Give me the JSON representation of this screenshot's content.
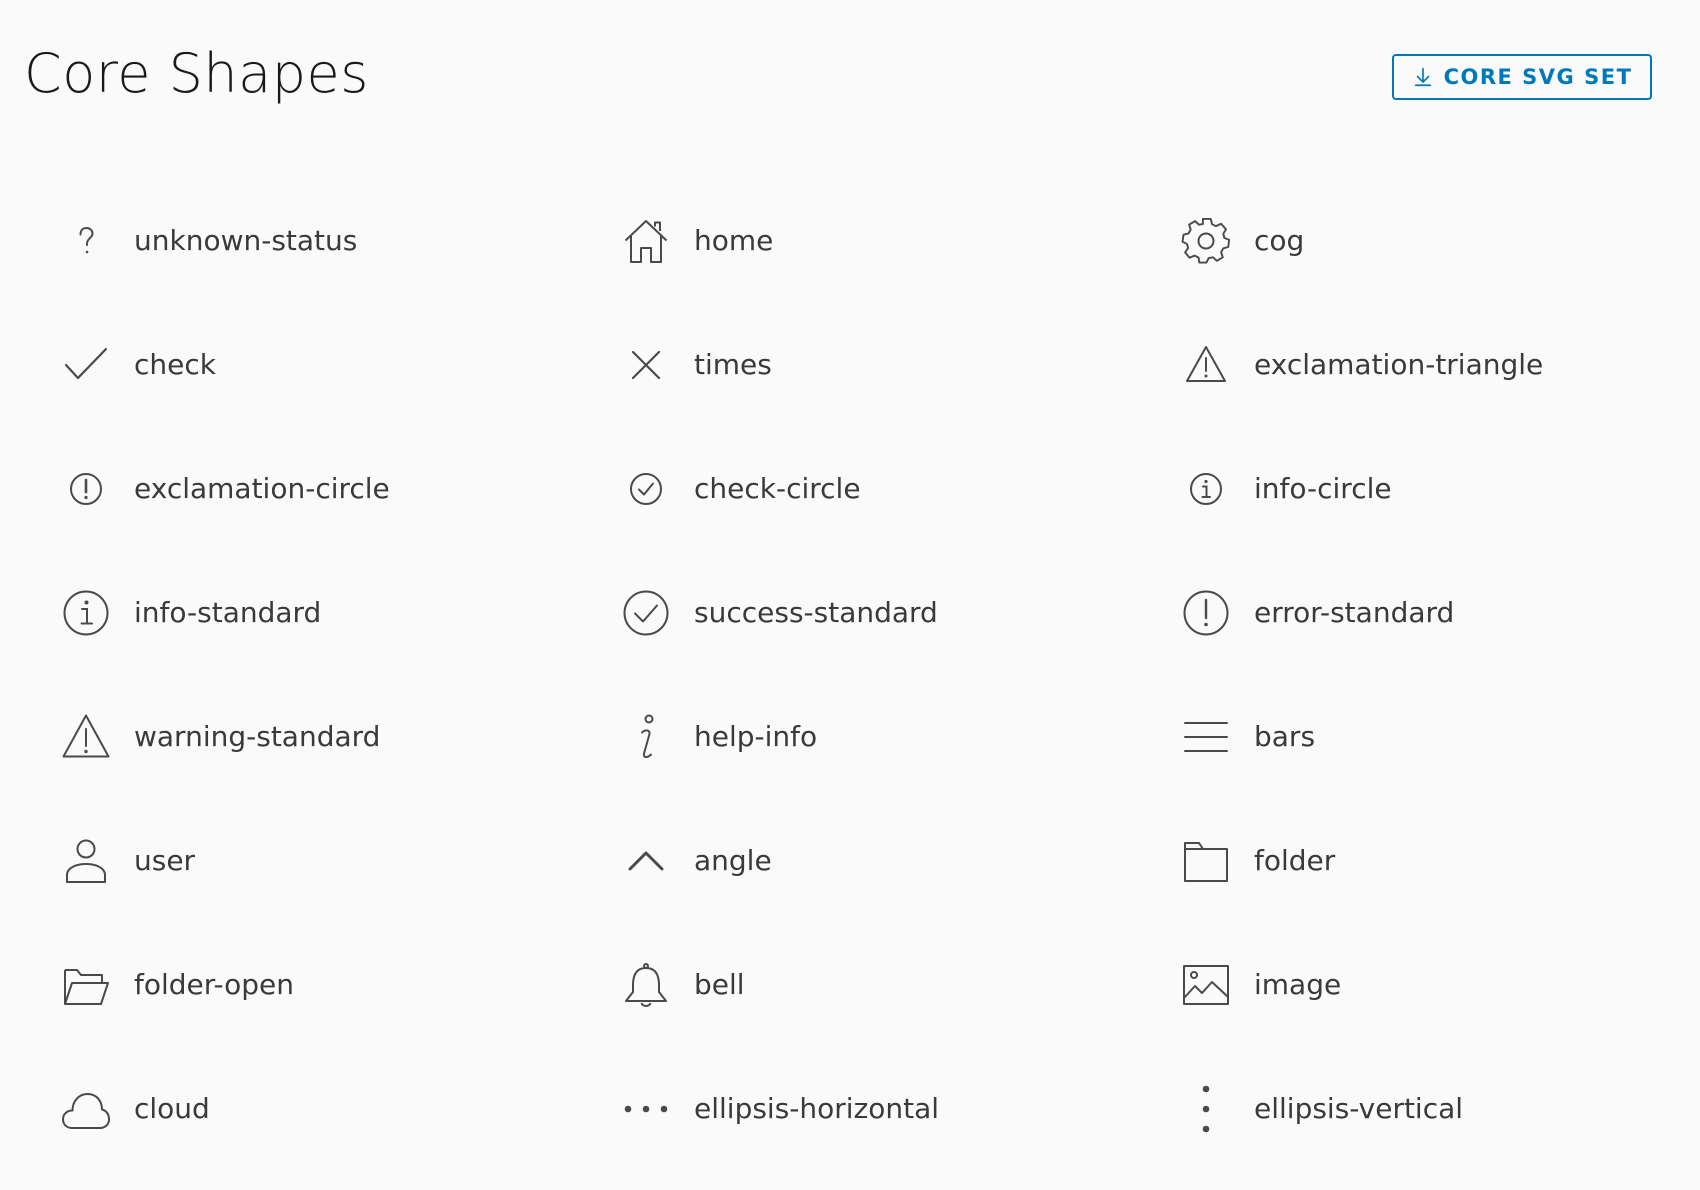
{
  "page": {
    "title": "Core Shapes"
  },
  "download_button": {
    "label": "CORE SVG SET",
    "icon": "download-icon",
    "color": "#0079b8"
  },
  "colors": {
    "icon_stroke": "#4a4a4a",
    "label_text": "#3a3a3a",
    "background": "#fafafa"
  },
  "shapes": [
    {
      "label": "unknown-status",
      "icon": "unknown-status-icon"
    },
    {
      "label": "home",
      "icon": "home-icon"
    },
    {
      "label": "cog",
      "icon": "cog-icon"
    },
    {
      "label": "check",
      "icon": "check-icon"
    },
    {
      "label": "times",
      "icon": "times-icon"
    },
    {
      "label": "exclamation-triangle",
      "icon": "exclamation-triangle-icon"
    },
    {
      "label": "exclamation-circle",
      "icon": "exclamation-circle-icon"
    },
    {
      "label": "check-circle",
      "icon": "check-circle-icon"
    },
    {
      "label": "info-circle",
      "icon": "info-circle-icon"
    },
    {
      "label": "info-standard",
      "icon": "info-standard-icon"
    },
    {
      "label": "success-standard",
      "icon": "success-standard-icon"
    },
    {
      "label": "error-standard",
      "icon": "error-standard-icon"
    },
    {
      "label": "warning-standard",
      "icon": "warning-standard-icon"
    },
    {
      "label": "help-info",
      "icon": "help-info-icon"
    },
    {
      "label": "bars",
      "icon": "bars-icon"
    },
    {
      "label": "user",
      "icon": "user-icon"
    },
    {
      "label": "angle",
      "icon": "angle-icon"
    },
    {
      "label": "folder",
      "icon": "folder-icon"
    },
    {
      "label": "folder-open",
      "icon": "folder-open-icon"
    },
    {
      "label": "bell",
      "icon": "bell-icon"
    },
    {
      "label": "image",
      "icon": "image-icon"
    },
    {
      "label": "cloud",
      "icon": "cloud-icon"
    },
    {
      "label": "ellipsis-horizontal",
      "icon": "ellipsis-horizontal-icon"
    },
    {
      "label": "ellipsis-vertical",
      "icon": "ellipsis-vertical-icon"
    }
  ]
}
